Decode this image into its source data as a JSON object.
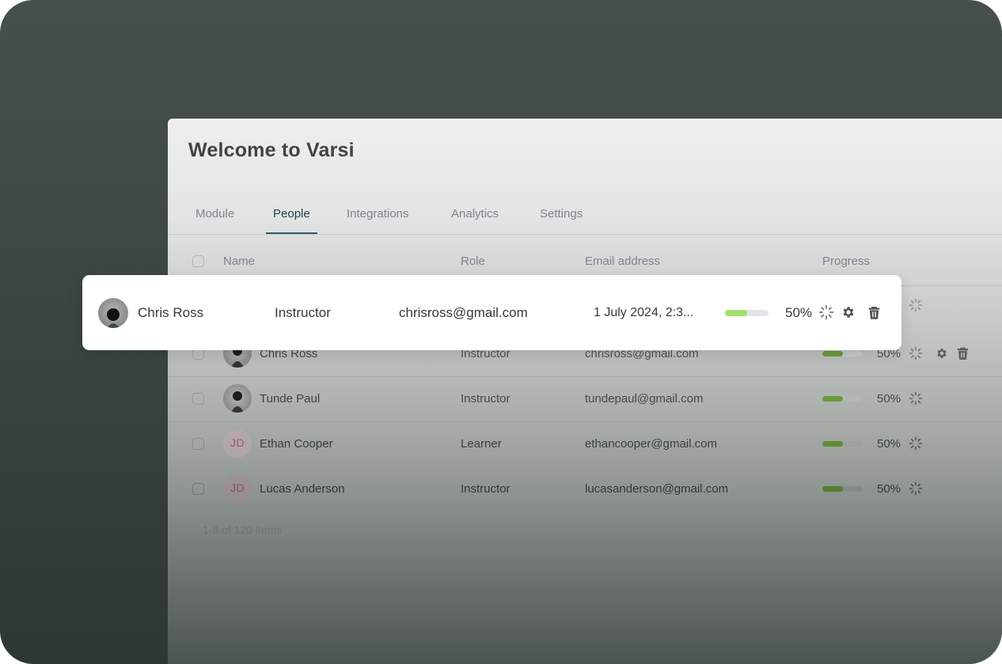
{
  "app": {
    "title": "Welcome to Varsi"
  },
  "tabs": [
    {
      "label": "Module",
      "active": false
    },
    {
      "label": "People",
      "active": true
    },
    {
      "label": "Integrations",
      "active": false
    },
    {
      "label": "Analytics",
      "active": false
    },
    {
      "label": "Settings",
      "active": false
    }
  ],
  "table": {
    "headers": {
      "name": "Name",
      "role": "Role",
      "email": "Email address",
      "progress": "Progress"
    },
    "rows": [
      {
        "name": "Chris Ross",
        "role": "Instructor",
        "email": "chrisross@gmail.com",
        "progress": 0.5,
        "progress_label": "50%",
        "avatar": "photo",
        "initials": ""
      },
      {
        "name": "Tunde Paul",
        "role": "Instructor",
        "email": "tundepaul@gmail.com",
        "progress": 0.5,
        "progress_label": "50%",
        "avatar": "photo",
        "initials": ""
      },
      {
        "name": "Ethan Cooper",
        "role": "Learner",
        "email": "ethancooper@gmail.com",
        "progress": 0.5,
        "progress_label": "50%",
        "avatar": "initials",
        "initials": "JD"
      },
      {
        "name": "Lucas Anderson",
        "role": "Instructor",
        "email": "lucasanderson@gmail.com",
        "progress": 0.5,
        "progress_label": "50%",
        "avatar": "initials",
        "initials": "JD"
      }
    ],
    "pagination": "1-8 of 120 items"
  },
  "highlight": {
    "name": "Chris Ross",
    "role": "Instructor",
    "email": "chrisross@gmail.com",
    "date": "1 July 2024, 2:3...",
    "progress": 0.5,
    "progress_label": "50%"
  },
  "icons": {
    "loading": "loading-icon",
    "settings": "gear-icon",
    "delete": "trash-icon"
  },
  "colors": {
    "accent": "#2c5b68",
    "progress_fill": "#a5df6a",
    "progress_fill_dim": "#6b9a3e"
  }
}
